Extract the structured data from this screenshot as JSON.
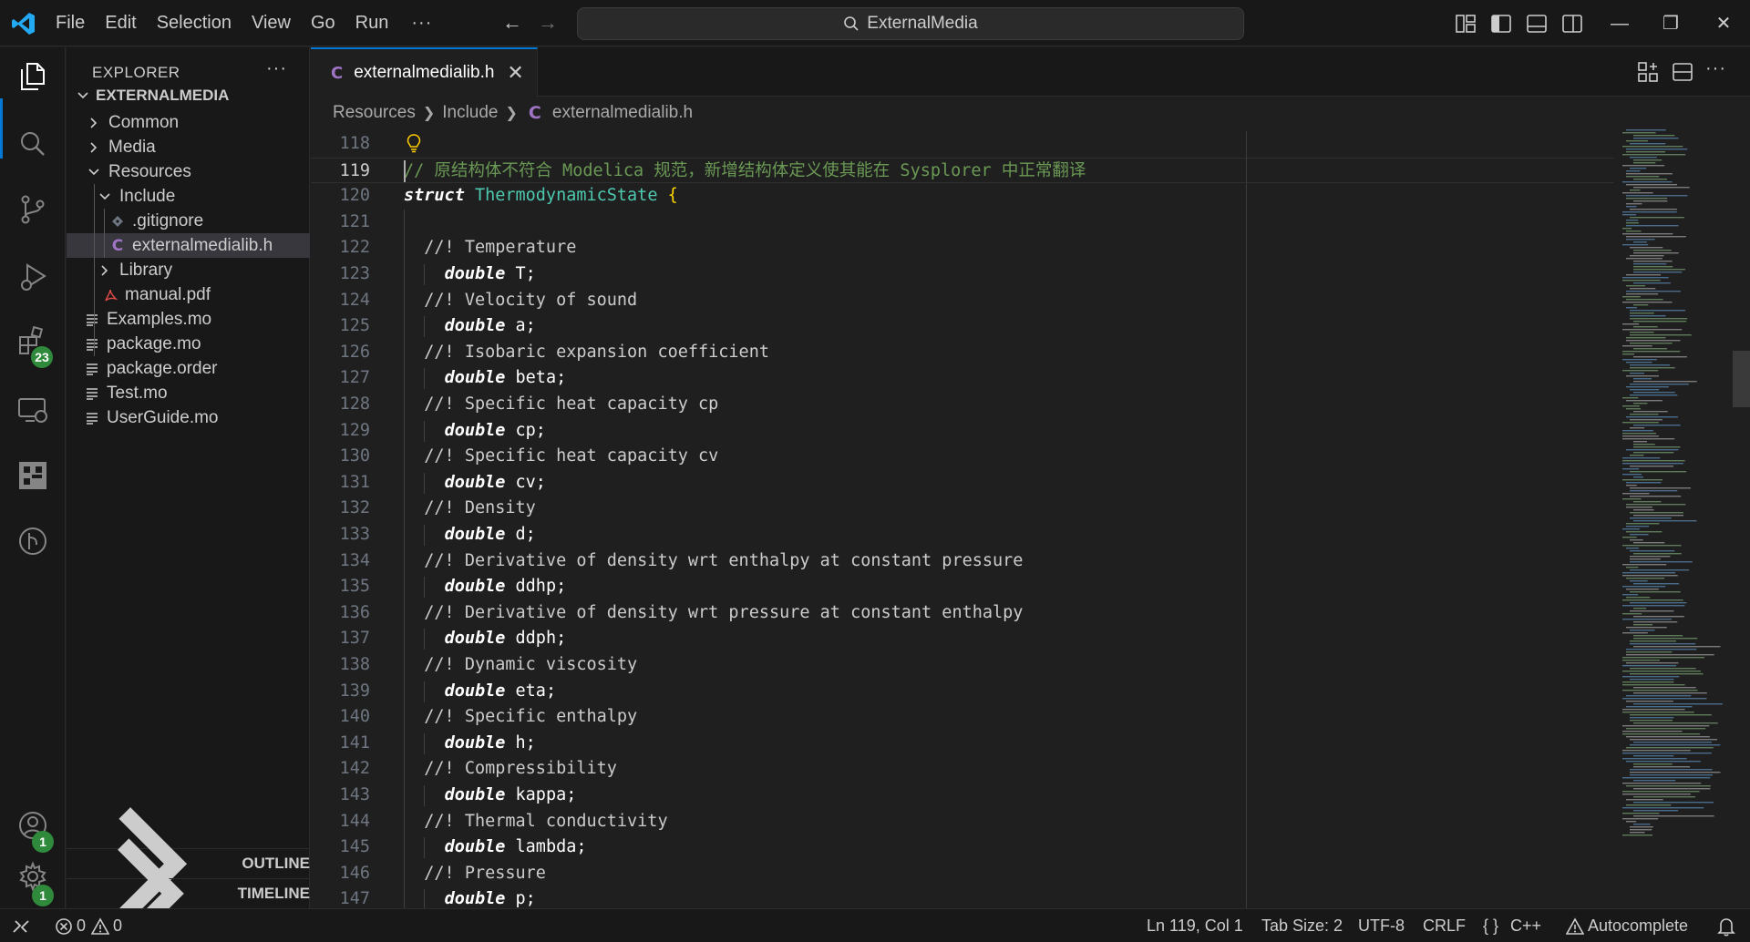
{
  "titlebar": {
    "menu": [
      "File",
      "Edit",
      "Selection",
      "View",
      "Go",
      "Run"
    ],
    "more": "···",
    "search_label": "ExternalMedia"
  },
  "activitybar": {
    "extensions_badge": "23",
    "accounts_badge": "1",
    "settings_badge": "1"
  },
  "sidebar": {
    "title": "EXPLORER",
    "more": "···",
    "root": "EXTERNALMEDIA",
    "tree": [
      {
        "label": "Common",
        "type": "folder",
        "expanded": false,
        "depth": 1
      },
      {
        "label": "Media",
        "type": "folder",
        "expanded": false,
        "depth": 1
      },
      {
        "label": "Resources",
        "type": "folder",
        "expanded": true,
        "depth": 1
      },
      {
        "label": "Include",
        "type": "folder",
        "expanded": true,
        "depth": 2
      },
      {
        "label": ".gitignore",
        "type": "git",
        "depth": 3
      },
      {
        "label": "externalmedialib.h",
        "type": "c",
        "depth": 3,
        "selected": true
      },
      {
        "label": "Library",
        "type": "folder",
        "expanded": false,
        "depth": 2
      },
      {
        "label": "manual.pdf",
        "type": "pdf",
        "depth": 2
      },
      {
        "label": "Examples.mo",
        "type": "text",
        "depth": 1
      },
      {
        "label": "package.mo",
        "type": "text",
        "depth": 1
      },
      {
        "label": "package.order",
        "type": "text",
        "depth": 1
      },
      {
        "label": "Test.mo",
        "type": "text",
        "depth": 1
      },
      {
        "label": "UserGuide.mo",
        "type": "text",
        "depth": 1
      }
    ],
    "outline": "OUTLINE",
    "timeline": "TIMELINE"
  },
  "editor": {
    "tab_label": "externalmedialib.h",
    "tab_icon_letter": "C",
    "breadcrumbs": [
      "Resources",
      "Include",
      "externalmedialib.h"
    ],
    "more": "···",
    "lines": [
      {
        "n": "118",
        "text": ""
      },
      {
        "n": "119",
        "text": "// 原结构体不符合 Modelica 规范，新增结构体定义使其能在 Sysplorer 中正常翻译"
      },
      {
        "n": "120",
        "text": "struct ThermodynamicState {"
      },
      {
        "n": "121",
        "text": ""
      },
      {
        "n": "122",
        "text": "  //! Temperature"
      },
      {
        "n": "123",
        "text": "    double T;"
      },
      {
        "n": "124",
        "text": "  //! Velocity of sound"
      },
      {
        "n": "125",
        "text": "    double a;"
      },
      {
        "n": "126",
        "text": "  //! Isobaric expansion coefficient"
      },
      {
        "n": "127",
        "text": "    double beta;"
      },
      {
        "n": "128",
        "text": "  //! Specific heat capacity cp"
      },
      {
        "n": "129",
        "text": "    double cp;"
      },
      {
        "n": "130",
        "text": "  //! Specific heat capacity cv"
      },
      {
        "n": "131",
        "text": "    double cv;"
      },
      {
        "n": "132",
        "text": "  //! Density"
      },
      {
        "n": "133",
        "text": "    double d;"
      },
      {
        "n": "134",
        "text": "  //! Derivative of density wrt enthalpy at constant pressure"
      },
      {
        "n": "135",
        "text": "    double ddhp;"
      },
      {
        "n": "136",
        "text": "  //! Derivative of density wrt pressure at constant enthalpy"
      },
      {
        "n": "137",
        "text": "    double ddph;"
      },
      {
        "n": "138",
        "text": "  //! Dynamic viscosity"
      },
      {
        "n": "139",
        "text": "    double eta;"
      },
      {
        "n": "140",
        "text": "  //! Specific enthalpy"
      },
      {
        "n": "141",
        "text": "    double h;"
      },
      {
        "n": "142",
        "text": "  //! Compressibility"
      },
      {
        "n": "143",
        "text": "    double kappa;"
      },
      {
        "n": "144",
        "text": "  //! Thermal conductivity"
      },
      {
        "n": "145",
        "text": "    double lambda;"
      },
      {
        "n": "146",
        "text": "  //! Pressure"
      },
      {
        "n": "147",
        "text": "    double p;"
      }
    ]
  },
  "statusbar": {
    "errors": "0",
    "warnings": "0",
    "position": "Ln 119, Col 1",
    "tab_size": "Tab Size: 2",
    "encoding": "UTF-8",
    "eol": "CRLF",
    "language": "C++",
    "language_icon": "{ }",
    "autocomplete": "Autocomplete"
  },
  "colors": {
    "accent": "#0078d4",
    "c_file": "#a074c4",
    "keyword": "#569cd6",
    "type": "#4ec9b0",
    "comment": "#6a9955",
    "badge": "#2f8a3c"
  }
}
